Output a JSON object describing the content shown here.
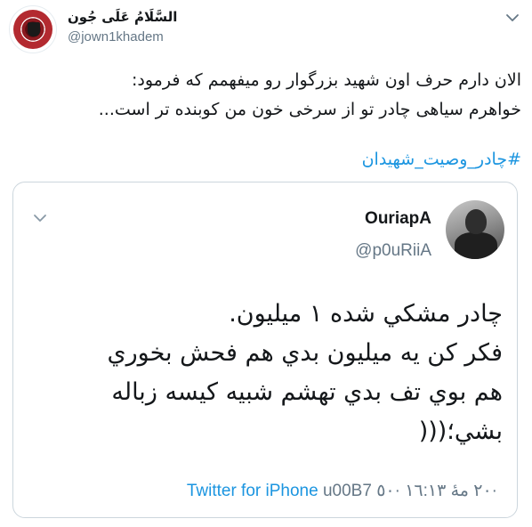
{
  "author": {
    "display_name": "السَّلَامُ عَلَى جُون",
    "handle": "@jown1khadem",
    "avatar_icon": "seal-avatar-icon"
  },
  "tweet": {
    "lines": [
      "الان دارم حرف اون شهید بزرگوار رو میفهمم که فرمود:",
      "خواهرم سیاهی چادر تو از سرخی خون من کوبنده تر است..."
    ],
    "hashtag": "#چادر_وصیت_شهیدان"
  },
  "quoted": {
    "display_name": "OuriapA",
    "handle": "@p0uRiiA",
    "lines": [
      "چادر مشکي شده ١ ميليون.",
      "فکر کن يه ميليون بدي هم فحش بخوري",
      "هم بوي تف بدي تهشم شبيه کيسه زباله",
      "بشي؛((("
    ],
    "source": "Twitter for iPhone",
    "meta": "u00B7 ٢٠ مهٔ ١٦:١٣ ·٥٠·"
  },
  "colors": {
    "link": "#1b95e0",
    "text": "#14171a",
    "muted": "#657786",
    "border": "#ccd6dd"
  }
}
